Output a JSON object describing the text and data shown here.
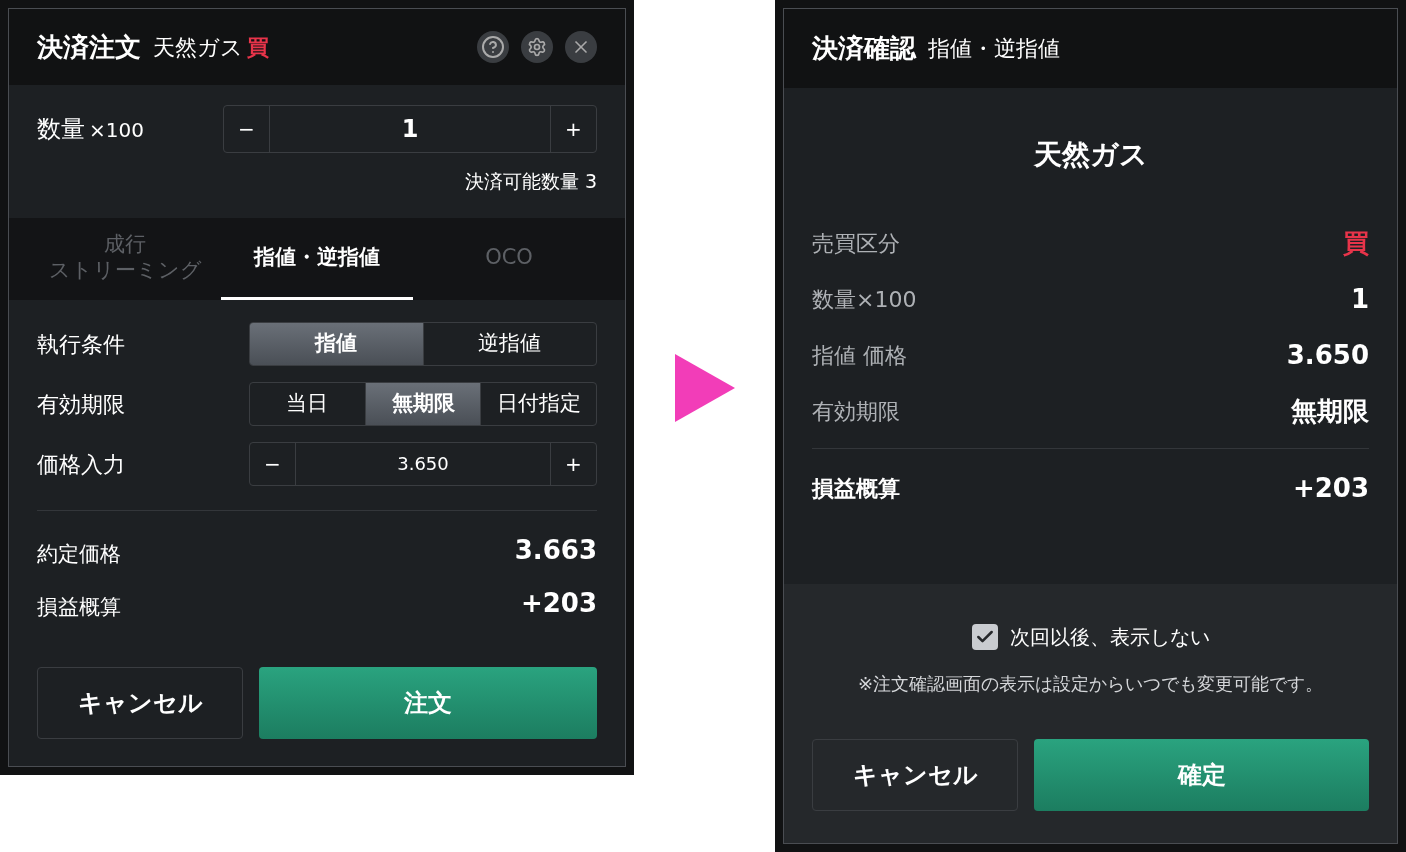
{
  "order_panel": {
    "title": "決済注文",
    "product": "天然ガス",
    "side": "買",
    "quantity": {
      "label": "数量",
      "unit": "×100",
      "minus": "−",
      "value": "1",
      "plus": "+"
    },
    "available": "決済可能数量 3",
    "tabs": [
      {
        "lines": [
          "成行",
          "ストリーミング"
        ],
        "selected": false
      },
      {
        "lines": [
          "指値・逆指値"
        ],
        "selected": true
      },
      {
        "lines": [
          "OCO"
        ],
        "selected": false
      }
    ],
    "conditions": [
      {
        "kind": "segments",
        "label": "執行条件",
        "options": [
          {
            "label": "指値",
            "selected": true
          },
          {
            "label": "逆指値",
            "selected": false
          }
        ]
      },
      {
        "kind": "segments",
        "label": "有効期限",
        "options": [
          {
            "label": "当日",
            "selected": false
          },
          {
            "label": "無期限",
            "selected": true
          },
          {
            "label": "日付指定",
            "selected": false
          }
        ]
      },
      {
        "kind": "stepper",
        "label": "価格入力",
        "minus": "−",
        "value": "3.650",
        "plus": "+"
      }
    ],
    "summary": [
      {
        "label": "約定価格",
        "value": "3.663"
      },
      {
        "label": "損益概算",
        "value": "+203"
      }
    ],
    "buttons": {
      "cancel": "キャンセル",
      "submit": "注文"
    }
  },
  "confirm_panel": {
    "title": "決済確認",
    "subtitle": "指値・逆指値",
    "product": "天然ガス",
    "rows": [
      {
        "label": "売買区分",
        "value": "買",
        "color": "#e8344a"
      },
      {
        "label": "数量×100",
        "value": "1",
        "color": "#ffffff"
      },
      {
        "label": "指値 価格",
        "value": "3.650",
        "color": "#ffffff"
      },
      {
        "label": "有効期限",
        "value": "無期限",
        "color": "#ffffff"
      }
    ],
    "total": {
      "label": "損益概算",
      "value": "+203"
    },
    "dont_show": {
      "label": "次回以後、表示しない",
      "checked": true
    },
    "note": "※注文確認画面の表示は設定からいつでも変更可能です。",
    "buttons": {
      "cancel": "キャンセル",
      "confirm": "確定"
    }
  }
}
